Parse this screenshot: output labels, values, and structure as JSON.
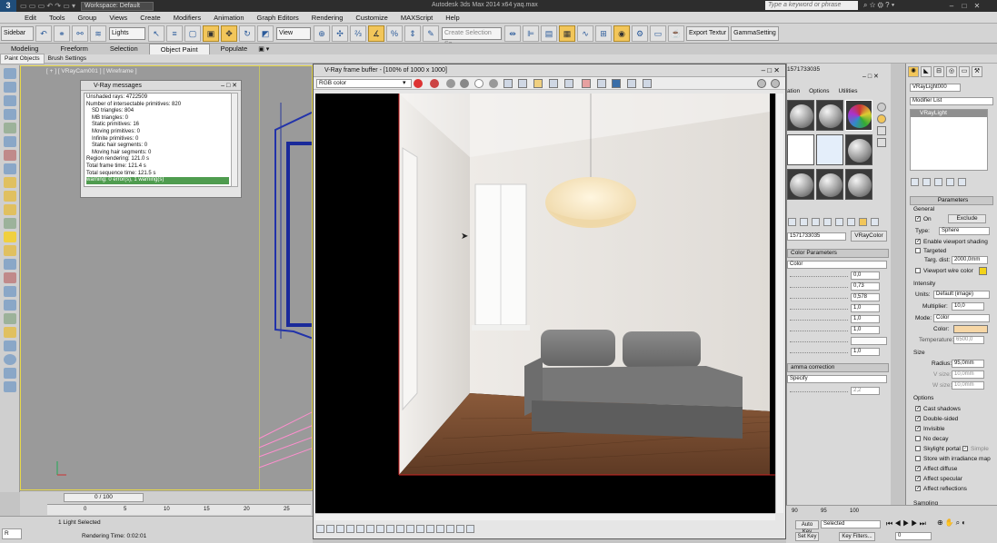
{
  "titlebar": {
    "workspace": "Workspace: Default",
    "title": "Autodesk 3ds Max 2014 x64    yaq.max",
    "search_placeholder": "Type a keyword or phrase"
  },
  "menu": [
    "Edit",
    "Tools",
    "Group",
    "Views",
    "Create",
    "Modifiers",
    "Animation",
    "Graph Editors",
    "Rendering",
    "Customize",
    "MAXScript",
    "Help"
  ],
  "toolbar": {
    "selset": "Sidebar",
    "layer": "Lights",
    "view": "View",
    "create_sel": "Create Selection Se",
    "export_label": "Export Textur",
    "gamma_label": "GammaSetting"
  },
  "ribbon": {
    "tabs": [
      "Modeling",
      "Freeform",
      "Selection",
      "Object Paint",
      "Populate"
    ],
    "active": "Object Paint",
    "subtabs": [
      "Paint Objects",
      "Brush Settings"
    ]
  },
  "viewport": {
    "label": "[ + ] [ VRayCam001 ] [ Wireframe ]"
  },
  "vray_messages": {
    "title": "V-Ray messages",
    "lines": [
      "Unshaded rays: 4722509",
      "Number of intersectable primitives: 820",
      "SD triangles: 804",
      "MB triangles: 0",
      "Static primitives: 16",
      "Moving primitives: 0",
      "Infinite primitives: 0",
      "Static hair segments: 0",
      "Moving hair segments: 0",
      "Region rendering: 121.0 s",
      "Total frame time: 121.4 s",
      "Total sequence time: 121.5 s",
      "warning: 0 error(s), 1 warning(s)"
    ]
  },
  "vfb": {
    "title": "V-Ray frame buffer - [100% of 1000 x 1000]",
    "channel": "RGB color"
  },
  "material_editor": {
    "name_field": "1571733035",
    "name_field2": "1571733035",
    "type_button": "VRayColor",
    "menu": [
      "ation",
      "Options",
      "Utilities"
    ],
    "section_params": "Color Parameters",
    "color_label": "Color",
    "values": [
      "0,0",
      "0,73",
      "0,578",
      "1,0",
      "1,0",
      "1,0",
      "1,0",
      "1,0"
    ],
    "section_gamma": "amma correction",
    "gamma_mode": "Specify",
    "gamma_value": "2,2"
  },
  "command_panel": {
    "object_name": "VRayLight000",
    "modifier_list": "Modifier List",
    "stack_item": "VRayLight",
    "rollout_params": "Parameters",
    "general": "General",
    "on_label": "On",
    "exclude": "Exclude",
    "type_label": "Type:",
    "type_value": "Sphere",
    "enable_viewport_shading": "Enable viewport shading",
    "targeted": "Targeted",
    "targ_dist_label": "Targ. dist:",
    "targ_dist": "2000,0mm",
    "viewport_wire_color": "Viewport wire color",
    "intensity": "Intensity",
    "units_label": "Units:",
    "units_value": "Default (image)",
    "multiplier_label": "Multiplier:",
    "multiplier": "10,0",
    "mode_label": "Mode:",
    "mode_value": "Color",
    "color_label": "Color:",
    "temp_label": "Temperature:",
    "temp_value": "6500,0",
    "size": "Size",
    "radius_label": "Radius:",
    "radius": "95,0mm",
    "v_size_label": "V size:",
    "v_size": "10,0mm",
    "w_size_label": "W size:",
    "w_size": "10,0mm",
    "options": "Options",
    "opts": [
      "Cast shadows",
      "Double-sided",
      "Invisible",
      "No decay",
      "Skylight portal",
      "Store with irradiance map",
      "Affect diffuse",
      "Affect specular",
      "Affect reflections"
    ],
    "opts_checked": [
      true,
      true,
      true,
      false,
      false,
      false,
      true,
      true,
      true
    ],
    "simple": "Simple",
    "sampling": "Sampling"
  },
  "timeline": {
    "frame": "0 / 100",
    "ticks": [
      "0",
      "5",
      "10",
      "15",
      "20",
      "25"
    ]
  },
  "status": {
    "selected": "1 Light Selected",
    "render_time": "Rendering Time: 0:02:01",
    "script": "R"
  },
  "bottomright": {
    "ticks": [
      "90",
      "95",
      "100"
    ],
    "autokey": "Auto Key",
    "selected": "Selected",
    "setkey": "Set Key",
    "keyfilters": "Key Filters...",
    "frame": "0"
  },
  "colors": {
    "selection_highlight": "#f2c65a",
    "viewport_border": "#e8d84a",
    "light_color_swatch": "#f7d7a6",
    "wire_color_swatch": "#f2d21a"
  }
}
